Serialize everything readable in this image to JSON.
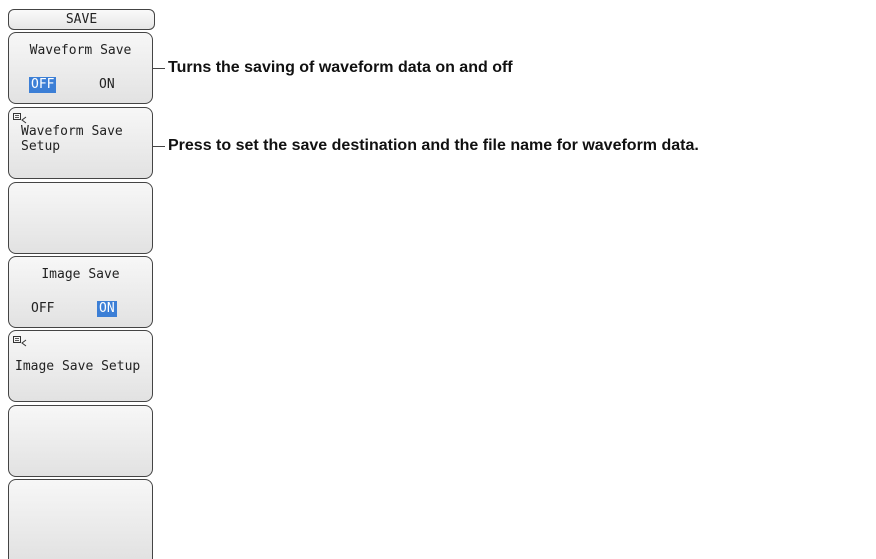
{
  "panel": {
    "title": "SAVE",
    "keys": [
      {
        "label": "Waveform Save",
        "off": "OFF",
        "on": "ON",
        "selected": "OFF"
      },
      {
        "label": "Waveform Save\nSetup"
      },
      {
        "label": ""
      },
      {
        "label": "Image Save",
        "off": "OFF",
        "on": "ON",
        "selected": "ON"
      },
      {
        "label": "Image Save Setup"
      },
      {
        "label": ""
      },
      {
        "label": ""
      }
    ]
  },
  "annotations": {
    "waveform_save": "Turns the saving of waveform data on and off",
    "waveform_setup": "Press to set the save destination and the file name for waveform data."
  },
  "colors": {
    "selected_bg": "#3c7fd6",
    "panel_border": "#444444"
  }
}
